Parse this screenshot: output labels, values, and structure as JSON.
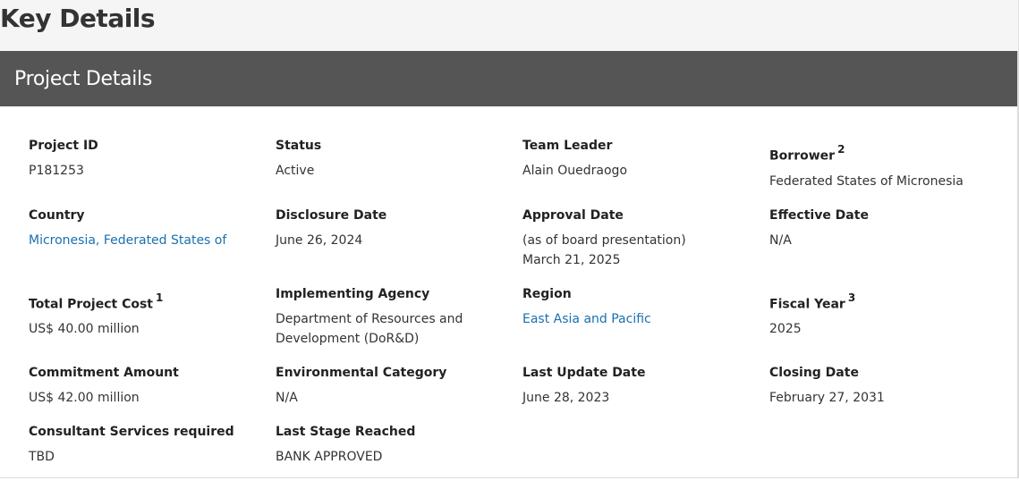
{
  "page": {
    "title": "Key Details"
  },
  "section": {
    "title": "Project Details"
  },
  "colors": {
    "header_bg": "#555555",
    "link": "#1a70b0",
    "page_bg": "#f5f5f5"
  },
  "fields": [
    {
      "label": "Project ID",
      "value": "P181253"
    },
    {
      "label": "Status",
      "value": "Active"
    },
    {
      "label": "Team Leader",
      "value": "Alain Ouedraogo"
    },
    {
      "label": "Borrower",
      "sup": "2",
      "value": "Federated States of Micronesia"
    },
    {
      "label": "Country",
      "value": "Micronesia, Federated States of",
      "link": true
    },
    {
      "label": "Disclosure Date",
      "value": "June 26, 2024"
    },
    {
      "label": "Approval Date",
      "value": "(as of board presentation)",
      "value2": "March 21, 2025"
    },
    {
      "label": "Effective Date",
      "value": "N/A"
    },
    {
      "label": "Total Project Cost",
      "sup": "1",
      "value": "US$ 40.00 million"
    },
    {
      "label": "Implementing Agency",
      "value": "Department of Resources and",
      "value2": "Development (DoR&D)"
    },
    {
      "label": "Region",
      "value": "East Asia and Pacific",
      "link": true
    },
    {
      "label": "Fiscal Year",
      "sup": "3",
      "value": "2025"
    },
    {
      "label": "Commitment Amount",
      "value": "US$ 42.00 million"
    },
    {
      "label": "Environmental Category",
      "value": "N/A"
    },
    {
      "label": "Last Update Date",
      "value": "June 28, 2023"
    },
    {
      "label": "Closing Date",
      "value": "February 27, 2031"
    },
    {
      "label": "Consultant Services required",
      "value": "TBD"
    },
    {
      "label": "Last Stage Reached",
      "value": "BANK APPROVED"
    }
  ]
}
